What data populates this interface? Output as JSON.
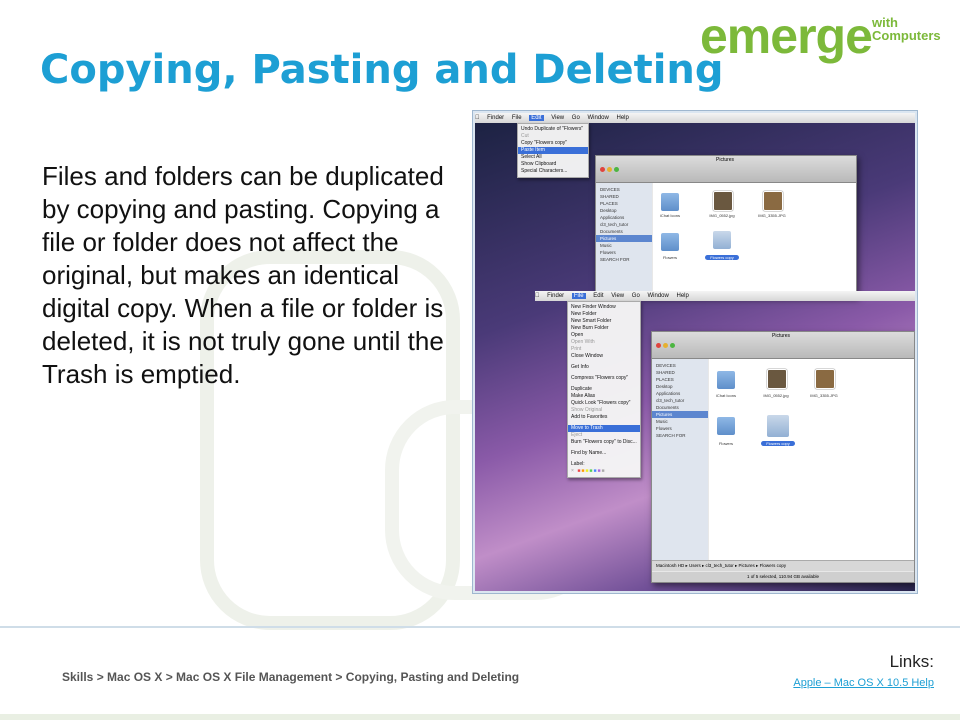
{
  "logo": {
    "main": "emerge",
    "sub_line1": "with",
    "sub_line2": "Computers"
  },
  "title": "Copying, Pasting and Deleting",
  "body": "Files and folders can be duplicated by copying and pasting. Copying a file or folder does not affect the original, but makes an identical digital copy. When a file or folder is deleted, it is not truly gone until the Trash is emptied.",
  "screenshot": {
    "top_menubar": [
      "Finder",
      "File",
      "Edit",
      "View",
      "Go",
      "Window",
      "Help"
    ],
    "edit_menu": [
      "Undo Duplicate of \"Flowers\"",
      "Cut",
      "Copy \"Flowers copy\"",
      "Paste Item",
      "Select All",
      "Show Clipboard",
      "Special Characters..."
    ],
    "file_menu": [
      "New Finder Window",
      "New Folder",
      "New Smart Folder",
      "New Burn Folder",
      "Open",
      "Open With",
      "Print",
      "Close Window",
      "Get Info",
      "Compress \"Flowers copy\"",
      "Duplicate",
      "Make Alias",
      "Quick Look \"Flowers copy\"",
      "Show Original",
      "Add to Favorites",
      "Move to Trash",
      "Eject",
      "Burn \"Flowers copy\" to Disc...",
      "Find by Name...",
      "Label:"
    ],
    "window_title": "Pictures",
    "sidebar": [
      "DEVICES",
      "SHARED",
      "PLACES",
      "Desktop",
      "Applications",
      "cl3_tech_tutor",
      "Documents",
      "Pictures",
      "Music",
      "Flowers",
      "SEARCH FOR"
    ],
    "files": [
      "iChat Icons",
      "IMG_0552.jpg",
      "IMG_3355.JPG",
      "Flowers",
      "Flowers copy"
    ],
    "path_bar": "Macintosh HD ▸ Users ▸ cl3_tech_tutor ▸ Pictures ▸ Flowers copy",
    "status": "1 of 5 selected, 110.94 GB available"
  },
  "breadcrumb": "Skills > Mac OS X > Mac OS X File Management > Copying, Pasting and Deleting",
  "links": {
    "label": "Links:",
    "items": [
      "Apple – Mac OS X 10.5 Help"
    ]
  },
  "colors": {
    "title": "#1d9fd4",
    "logo": "#7cb93a",
    "link": "#1d9fd4"
  }
}
